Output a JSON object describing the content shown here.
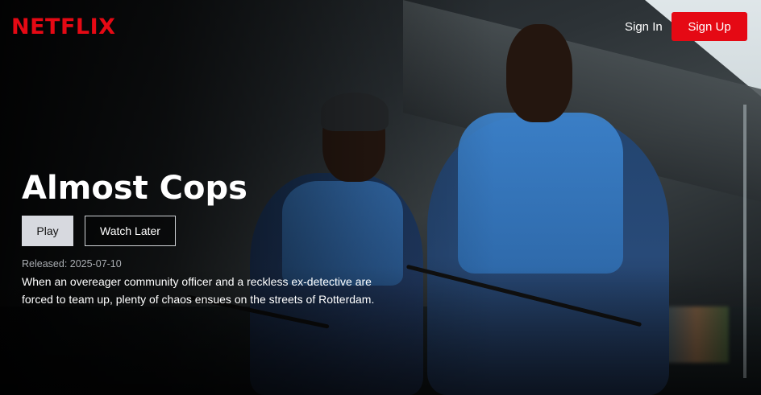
{
  "header": {
    "logo": "NETFLIX",
    "sign_in_label": "Sign In",
    "sign_up_label": "Sign Up"
  },
  "hero": {
    "title": "Almost Cops",
    "play_label": "Play",
    "watch_later_label": "Watch Later",
    "released_label": "Released: ",
    "released_date": "2025-07-10",
    "description": "When an overeager community officer and a reckless ex-detective are forced to team up, plenty of chaos ensues on the streets of Rotterdam."
  },
  "colors": {
    "brand_red": "#e50914",
    "play_button_bg": "#d7d9df",
    "text_primary": "#ffffff",
    "text_muted": "#a9adb2"
  }
}
